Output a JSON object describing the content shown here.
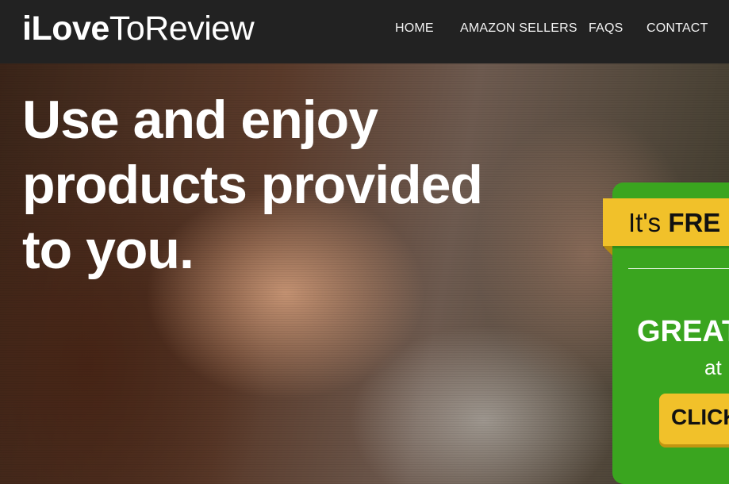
{
  "header": {
    "logo": {
      "part1": "iLove",
      "part2": "ToReview"
    },
    "nav": [
      {
        "label": "HOME"
      },
      {
        "label": "AMAZON SELLERS"
      },
      {
        "label": "FAQS"
      },
      {
        "label": "CONTACT"
      }
    ]
  },
  "hero": {
    "headline_lines": [
      "Use and enjoy",
      "products provided",
      "to you."
    ]
  },
  "promo": {
    "ribbon_lead": "It's ",
    "ribbon_bold": "FRE",
    "great": "GREAT",
    "at": "at",
    "button": "CLICK"
  },
  "colors": {
    "topbar": "#222222",
    "promo_green": "#3aa51f",
    "ribbon_yellow": "#f1c12a",
    "text_white": "#ffffff"
  }
}
